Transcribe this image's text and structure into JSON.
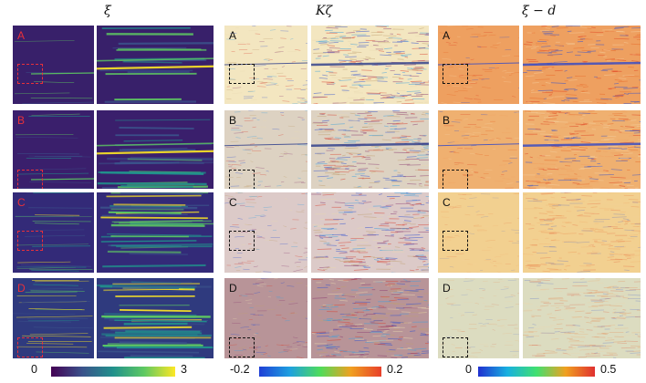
{
  "columns": [
    {
      "title": "ξ",
      "colorbar_min": "0",
      "colorbar_max": "3",
      "colormap": "viridis",
      "letter_color": "#e8303a",
      "roi_color": "#e8303a"
    },
    {
      "title": "Kζ",
      "colorbar_min": "-0.2",
      "colorbar_max": "0.2",
      "colormap": "blue-green-red diverging",
      "letter_color": "#111111",
      "roi_color": "#111111"
    },
    {
      "title": "ξ − d",
      "colorbar_min": "0",
      "colorbar_max": "0.5",
      "colormap": "blue-green-red",
      "letter_color": "#111111",
      "roi_color": "#111111"
    }
  ],
  "rows": [
    "A",
    "B",
    "C",
    "D"
  ],
  "colors": {
    "viridis_bg": "#3b1f6e",
    "kz_bg": "#e9d9b6",
    "xd_bg": "#f0b070"
  }
}
